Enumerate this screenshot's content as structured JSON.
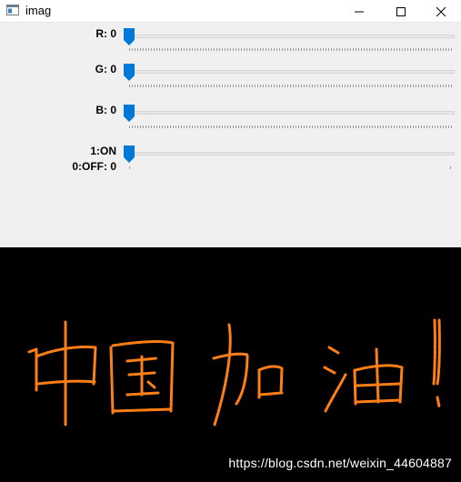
{
  "window": {
    "title": "imag",
    "icon": "app-window-icon",
    "buttons": [
      "minimize-icon",
      "maximize-icon",
      "close-icon"
    ]
  },
  "trackbars": [
    {
      "id": "r",
      "label": "R: 0",
      "value": 0,
      "max": 255
    },
    {
      "id": "g",
      "label": "G: 0",
      "value": 0,
      "max": 255
    },
    {
      "id": "b",
      "label": "B: 0",
      "value": 0,
      "max": 255
    },
    {
      "id": "switch",
      "label_line1": "1:ON",
      "label_line2": "0:OFF: 0",
      "value": 0,
      "max": 1
    }
  ],
  "image": {
    "background": "#000000",
    "stroke_color": "#ff7f17",
    "handwritten_text": "中国加油!",
    "watermark": "https://blog.csdn.net/weixin_44604887"
  },
  "colors": {
    "thumb": "#0078d7",
    "panel": "#f0f0f0"
  }
}
